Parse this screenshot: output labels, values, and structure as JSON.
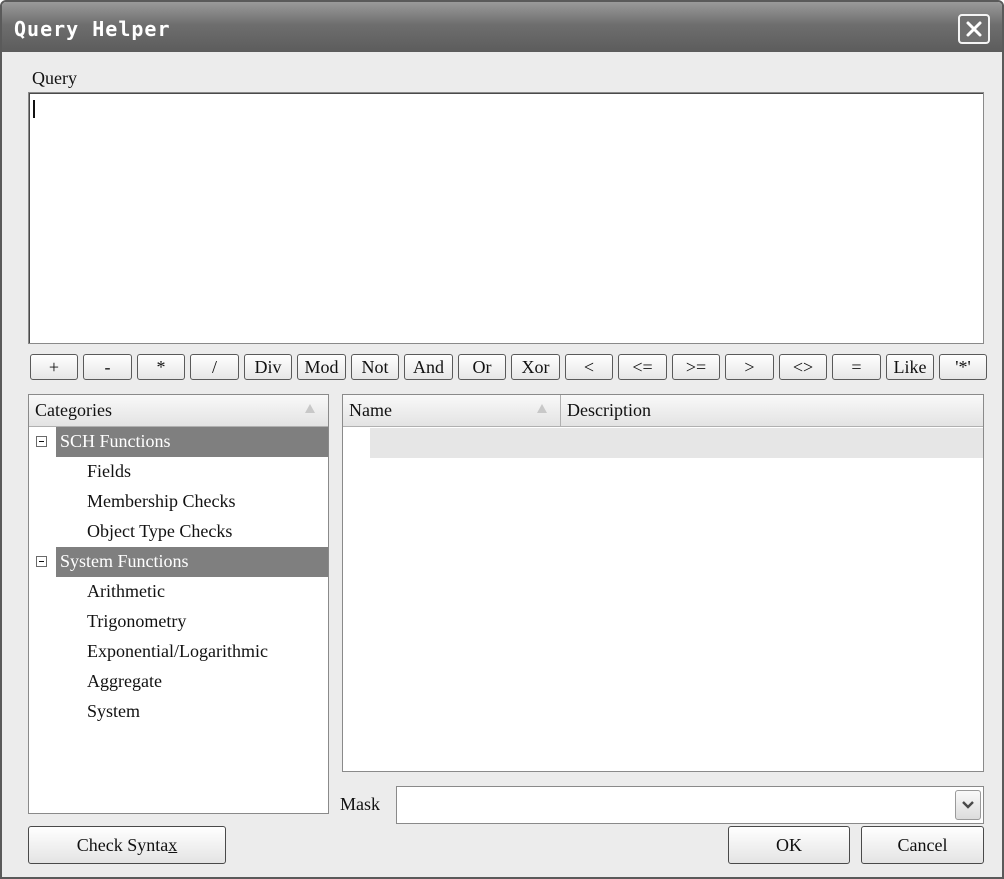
{
  "window": {
    "title": "Query Helper"
  },
  "query": {
    "label": "Query",
    "value": ""
  },
  "operators": [
    "+",
    "-",
    "*",
    "/",
    "Div",
    "Mod",
    "Not",
    "And",
    "Or",
    "Xor",
    "<",
    "<=",
    ">=",
    ">",
    "<>",
    "=",
    "Like",
    "'*'"
  ],
  "categories": {
    "header": "Categories",
    "groups": [
      {
        "label": "SCH Functions",
        "items": [
          "Fields",
          "Membership Checks",
          "Object Type Checks"
        ]
      },
      {
        "label": "System Functions",
        "items": [
          "Arithmetic",
          "Trigonometry",
          "Exponential/Logarithmic",
          "Aggregate",
          "System"
        ]
      }
    ]
  },
  "functions": {
    "name_header": "Name",
    "description_header": "Description"
  },
  "mask": {
    "label": "Mask",
    "value": ""
  },
  "buttons": {
    "check_syntax_prefix": "Check Synta",
    "check_syntax_accel": "x",
    "ok": "OK",
    "cancel": "Cancel"
  }
}
